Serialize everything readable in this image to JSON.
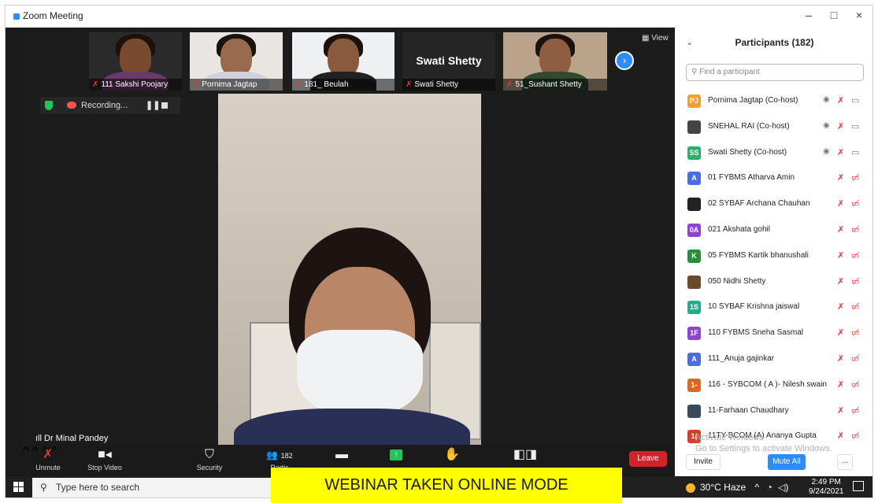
{
  "window": {
    "title": "Zoom Meeting",
    "minimize": "–",
    "maximize": "□",
    "close": "×"
  },
  "thumbnails": [
    {
      "name": "111 Sakshi Poojary",
      "muted": true
    },
    {
      "name": "Pornima Jagtap",
      "muted": true
    },
    {
      "name": "181_ Beulah",
      "muted": true
    },
    {
      "name": "Swati Shetty",
      "big_name": "Swati Shetty",
      "muted": true
    },
    {
      "name": "51_Sushant Shetty",
      "muted": true
    }
  ],
  "view_label": "View",
  "recording": {
    "label": "Recording...",
    "pause": "❚❚"
  },
  "speaker": {
    "name": "Dr Minal Pandey"
  },
  "toolbar": {
    "unmute": "Unmute",
    "stop_video": "Stop Video",
    "security": "Security",
    "participants": "Partic",
    "participant_count": "182",
    "leave": "Leave"
  },
  "panel": {
    "title": "Participants (182)",
    "search_placeholder": "Find a participant",
    "participants": [
      {
        "initials": "PJ",
        "color": "#f0a02c",
        "name": "Pornima Jagtap (Co-host)",
        "cohost": true
      },
      {
        "initials": "",
        "color": "#444444",
        "name": "SNEHAL RAI (Co-host)",
        "cohost": true
      },
      {
        "initials": "SS",
        "color": "#24b36b",
        "name": "Swati Shetty (Co-host)",
        "cohost": true
      },
      {
        "initials": "A",
        "color": "#4a6ee0",
        "name": "01 FYBMS Atharva Amin",
        "cohost": false
      },
      {
        "initials": "",
        "color": "#222222",
        "name": "02  SYBAF Archana Chauhan",
        "cohost": false
      },
      {
        "initials": "0A",
        "color": "#8e44d0",
        "name": "021 Akshata gohil",
        "cohost": false
      },
      {
        "initials": "K",
        "color": "#2e8b3e",
        "name": "05 FYBMS Kartik bhanushali",
        "cohost": false
      },
      {
        "initials": "",
        "color": "#6b4a2c",
        "name": "050 Nidhi Shetty",
        "cohost": false
      },
      {
        "initials": "1S",
        "color": "#1fb08a",
        "name": "10 SYBAF Krishna jaiswal",
        "cohost": false
      },
      {
        "initials": "1F",
        "color": "#8e44d0",
        "name": "110 FYBMS Sneha Sasmal",
        "cohost": false
      },
      {
        "initials": "A",
        "color": "#4a6ee0",
        "name": "111_Anuja gajinkar",
        "cohost": false
      },
      {
        "initials": "1-",
        "color": "#e0661f",
        "name": "116 - SYBCOM ( A )- Nilesh swain",
        "cohost": false
      },
      {
        "initials": "",
        "color": "#3a4a5a",
        "name": "11-Farhaan Chaudhary",
        "cohost": false
      },
      {
        "initials": "1(",
        "color": "#d0402a",
        "name": "11TY-BCOM (A) Ananya Gupta",
        "cohost": false
      }
    ],
    "watermark_line1": "Activate Windows",
    "watermark_line2": "Go to Settings to activate Windows.",
    "invite": "Invite",
    "mute_all": "Mute All",
    "more": "..."
  },
  "taskbar": {
    "search": "Type here to search",
    "weather": "30°C  Haze",
    "time": "2:49 PM",
    "date": "9/24/2021"
  },
  "caption": "WEBINAR TAKEN ONLINE MODE"
}
